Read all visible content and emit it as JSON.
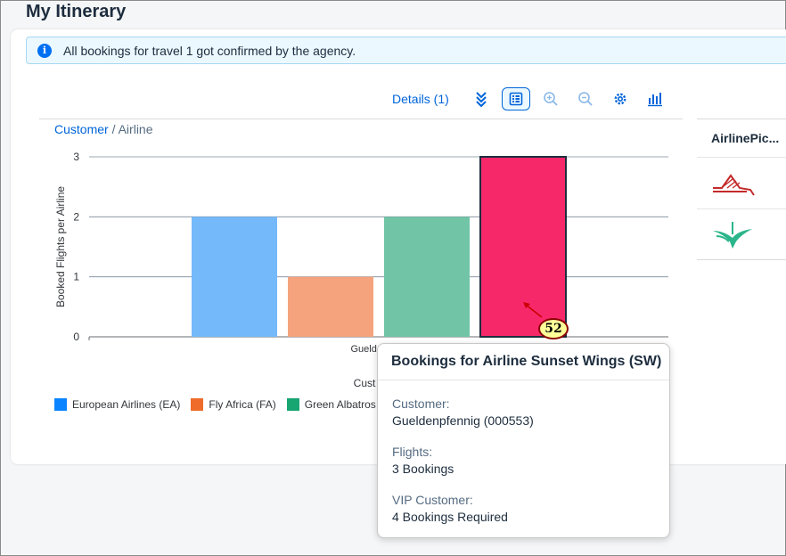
{
  "page": {
    "title": "My Itinerary"
  },
  "message_strip": {
    "icon": "info-icon",
    "text": "All bookings for travel 1 got confirmed by the agency."
  },
  "toolbar": {
    "details_label": "Details (1)",
    "buttons": [
      {
        "name": "drilldown-icon"
      },
      {
        "name": "legend-toggle-icon",
        "active": true
      },
      {
        "name": "zoom-in-icon"
      },
      {
        "name": "zoom-out-icon"
      },
      {
        "name": "settings-icon"
      },
      {
        "name": "chart-type-icon"
      }
    ]
  },
  "breadcrumb": {
    "link": "Customer",
    "separator": " / ",
    "current": "Airline"
  },
  "chart_data": {
    "type": "bar",
    "ylabel": "Booked Flights per Airline",
    "xlabel": "Cust",
    "categories": [
      "Gueldenpfen"
    ],
    "ylim": [
      0,
      3
    ],
    "yticks": [
      "0",
      "1",
      "2",
      "3"
    ],
    "grid": true,
    "series": [
      {
        "name": "European Airlines (EA)",
        "values": [
          2
        ],
        "color": "#74b9fa"
      },
      {
        "name": "Fly Africa (FA)",
        "values": [
          1
        ],
        "color": "#f4a37c"
      },
      {
        "name": "Green Albatros (",
        "values": [
          2
        ],
        "color": "#72c4a7"
      },
      {
        "name": "Sunset Wings (SW)",
        "values": [
          3
        ],
        "color": "#f7286a",
        "selected": true
      }
    ],
    "legend_position": "bottom-left"
  },
  "legend": {
    "items": [
      {
        "label": "European Airlines (EA)",
        "color": "#0a84ff"
      },
      {
        "label": "Fly Africa (FA)",
        "color": "#ef6b2b"
      },
      {
        "label": "Green Albatros (",
        "color": "#17a571"
      }
    ]
  },
  "side_table": {
    "header": "AirlinePic...",
    "rows": [
      {
        "icon": "airline-logo-red-icon"
      },
      {
        "icon": "airline-logo-green-icon"
      }
    ]
  },
  "popover": {
    "title": "Bookings for Airline Sunset Wings (SW)",
    "fields": [
      {
        "label": "Customer:",
        "value": "Gueldenpfennig (000553)"
      },
      {
        "label": "Flights:",
        "value": "3 Bookings"
      },
      {
        "label": "VIP Customer:",
        "value": "4 Bookings Required"
      }
    ]
  },
  "annotation": {
    "badge": "52"
  }
}
